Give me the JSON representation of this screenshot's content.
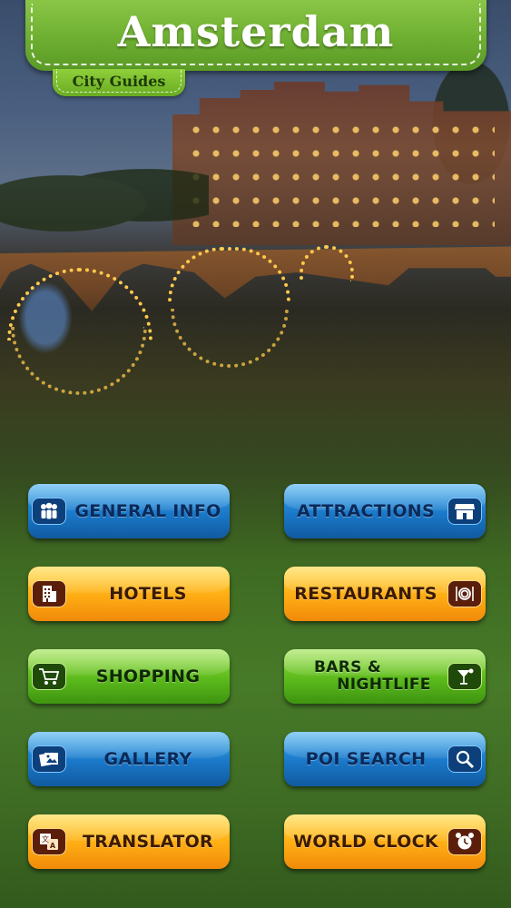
{
  "header": {
    "title": "Amsterdam",
    "subtitle": "City Guides"
  },
  "menu": {
    "general_info": {
      "label": "GENERAL INFO",
      "icon": "people-icon"
    },
    "attractions": {
      "label": "ATTRACTIONS",
      "icon": "storefront-icon"
    },
    "hotels": {
      "label": "HOTELS",
      "icon": "hotel-building-icon"
    },
    "restaurants": {
      "label": "RESTAURANTS",
      "icon": "plate-cutlery-icon"
    },
    "shopping": {
      "label": "SHOPPING",
      "icon": "shopping-cart-icon"
    },
    "bars_nightlife": {
      "label_line1": "BARS &",
      "label_line2": "NIGHTLIFE",
      "icon": "cocktail-icon"
    },
    "gallery": {
      "label": "GALLERY",
      "icon": "photos-icon"
    },
    "poi_search": {
      "label": "POI SEARCH",
      "icon": "magnifier-icon"
    },
    "translator": {
      "label": "TRANSLATOR",
      "icon": "translate-icon"
    },
    "world_clock": {
      "label": "WORLD CLOCK",
      "icon": "alarm-clock-icon"
    }
  },
  "colors": {
    "blue_button": "#1b78c8",
    "orange_button": "#ffac14",
    "green_button": "#5cba1c",
    "banner_green": "#6fb032"
  }
}
